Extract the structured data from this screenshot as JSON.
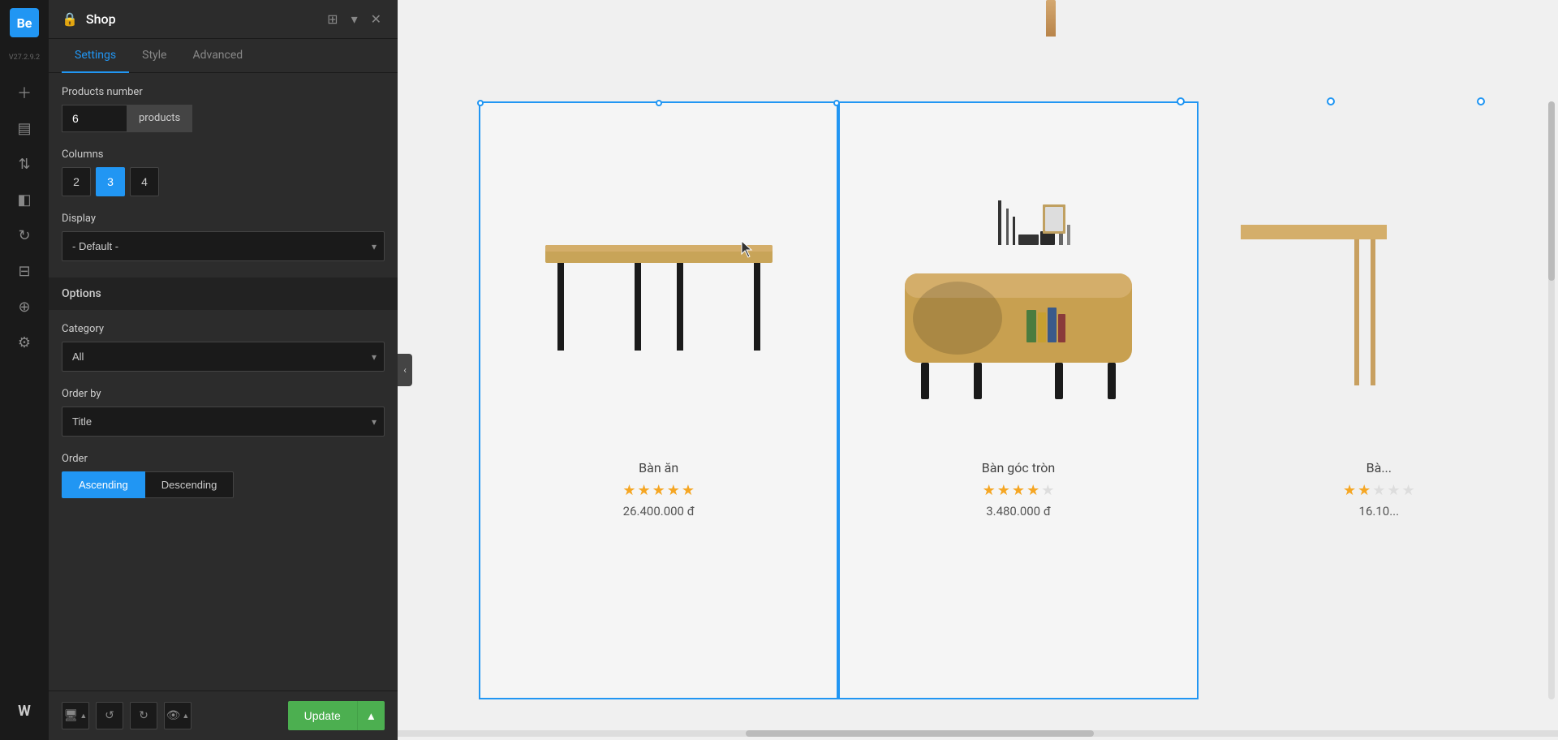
{
  "app": {
    "version": "V27.2.9.2",
    "logo": "Be",
    "panel_title": "Shop"
  },
  "tabs": {
    "settings": "Settings",
    "style": "Style",
    "advanced": "Advanced",
    "active": "settings"
  },
  "settings": {
    "products_number_label": "Products number",
    "products_number_value": "6",
    "products_suffix": "products",
    "columns_label": "Columns",
    "columns_options": [
      "2",
      "3",
      "4"
    ],
    "columns_active": "3",
    "display_label": "Display",
    "display_value": "- Default -",
    "options_header": "Options",
    "category_label": "Category",
    "category_value": "All",
    "order_by_label": "Order by",
    "order_by_value": "Title",
    "order_label": "Order",
    "order_ascending": "Ascending",
    "order_descending": "Descending"
  },
  "footer": {
    "update_btn": "Update"
  },
  "nav_icons": [
    {
      "name": "add-icon",
      "symbol": "+"
    },
    {
      "name": "chart-icon",
      "symbol": "▤"
    },
    {
      "name": "sort-icon",
      "symbol": "⇅"
    },
    {
      "name": "layers-icon",
      "symbol": "◫"
    },
    {
      "name": "refresh-icon",
      "symbol": "↻"
    },
    {
      "name": "sliders-icon",
      "symbol": "⊞"
    },
    {
      "name": "globe-icon",
      "symbol": "⊕"
    },
    {
      "name": "settings-icon",
      "symbol": "⚙"
    },
    {
      "name": "wordpress-icon",
      "symbol": "W"
    }
  ],
  "products": [
    {
      "name": "Bàn ăn",
      "stars": [
        1,
        1,
        1,
        1,
        1
      ],
      "price": "26.400.000 đ",
      "type": "dining"
    },
    {
      "name": "Bàn góc tròn",
      "stars": [
        1,
        1,
        1,
        1,
        0
      ],
      "price": "3.480.000 đ",
      "type": "sideboard"
    },
    {
      "name": "Bà...",
      "stars": [
        1,
        1,
        0,
        0,
        0
      ],
      "price": "16.10...",
      "type": "partial"
    }
  ]
}
